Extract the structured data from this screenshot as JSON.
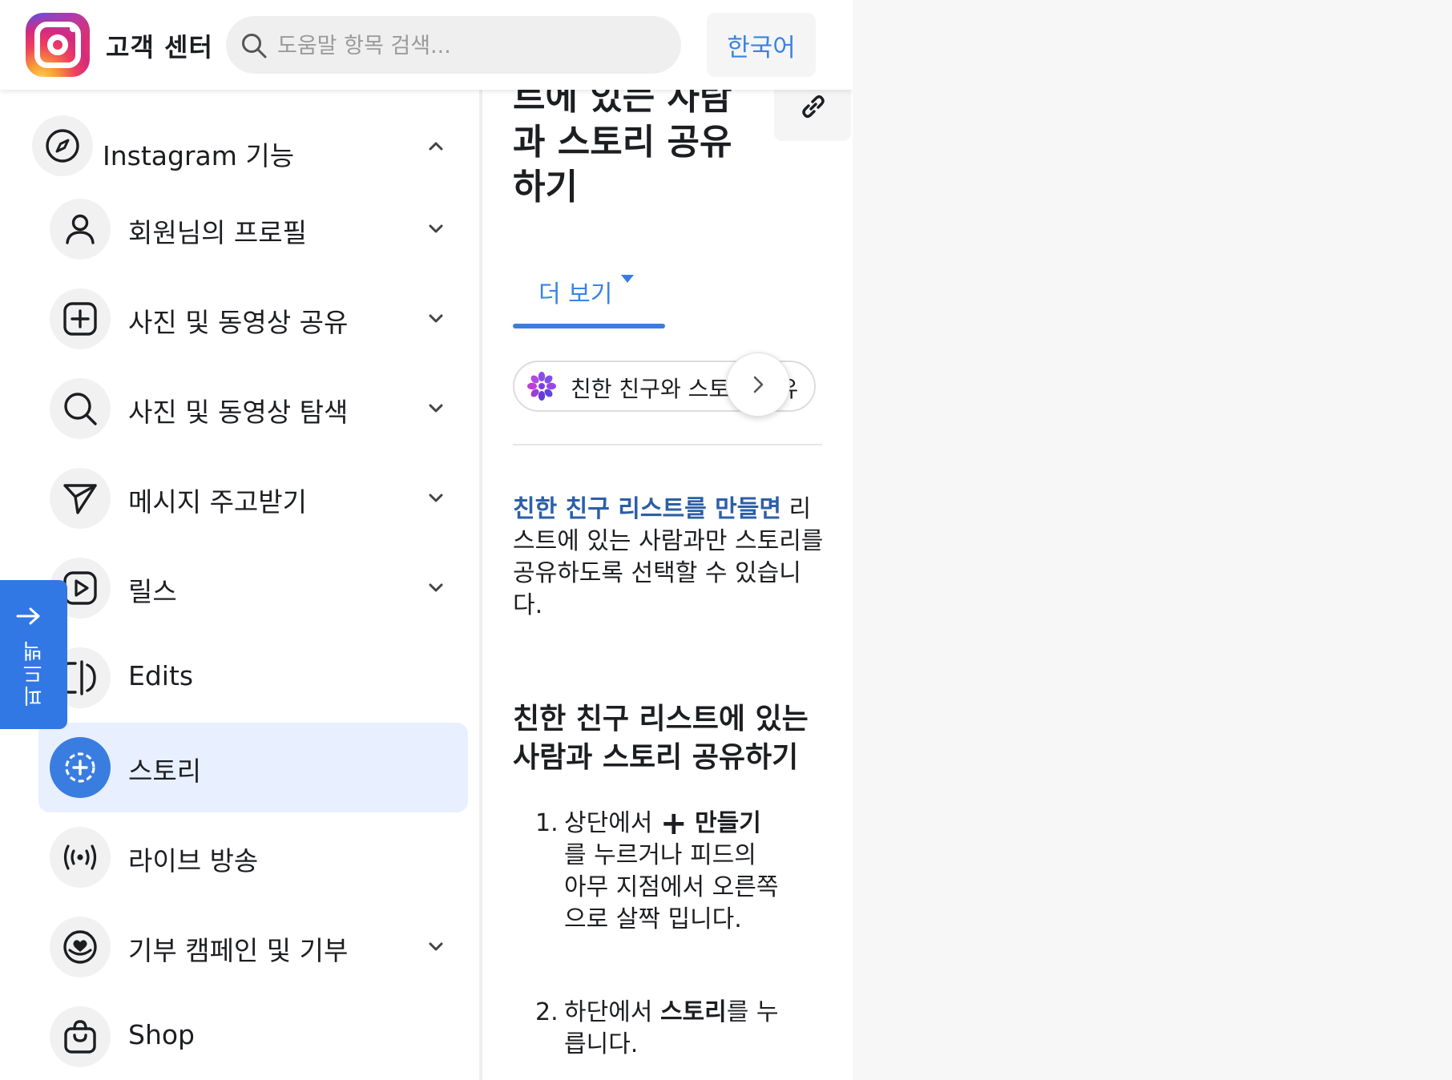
{
  "header": {
    "title": "고객 센터",
    "search_placeholder": "도움말 항목 검색...",
    "language_label": "한국어"
  },
  "sidebar": {
    "section": {
      "label": "Instagram 기능",
      "icon": "compass-icon",
      "expanded": true
    },
    "items": [
      {
        "label": "회원님의 프로필",
        "icon": "person-icon",
        "has_chevron": true,
        "active": false
      },
      {
        "label": "사진 및 동영상 공유",
        "icon": "plus-square-icon",
        "has_chevron": true,
        "active": false
      },
      {
        "label": "사진 및 동영상 탐색",
        "icon": "search-icon",
        "has_chevron": true,
        "active": false
      },
      {
        "label": "메시지 주고받기",
        "icon": "paper-plane-icon",
        "has_chevron": true,
        "active": false
      },
      {
        "label": "릴스",
        "icon": "reels-icon",
        "has_chevron": true,
        "active": false
      },
      {
        "label": "Edits",
        "icon": "edits-icon",
        "has_chevron": false,
        "active": false
      },
      {
        "label": "스토리",
        "icon": "story-add-icon",
        "has_chevron": false,
        "active": true
      },
      {
        "label": "라이브 방송",
        "icon": "live-broadcast-icon",
        "has_chevron": false,
        "active": false
      },
      {
        "label": "기부 캠페인 및 기부",
        "icon": "heart-donation-icon",
        "has_chevron": true,
        "active": false
      },
      {
        "label": "Shop",
        "icon": "shopping-bag-icon",
        "has_chevron": false,
        "active": false
      }
    ]
  },
  "feedback": {
    "label": "피드백"
  },
  "article": {
    "title_lines": [
      "트에 있는 사람",
      "과 스토리 공유",
      "하기"
    ],
    "more_label": "더 보기",
    "chip_label": "친한 친구와 스토리 공유",
    "intro_link": "친한 친구 리스트를 만들면",
    "intro_rest": " 리스트에 있는 사람과만 스토리를 공유하도록 선택할 수 있습니다.",
    "section_title": "친한 친구 리스트에 있는 사람과 스토리 공유하기",
    "steps": [
      {
        "num": "1.",
        "before": "상단에서 ",
        "icon_glyph": "+",
        "bold": "만들기",
        "after": "를 누르거나 피드의 아무 지점에서 오른쪽으로 살짝 밉니다."
      },
      {
        "num": "2.",
        "before": "하단에서 ",
        "bold": "스토리",
        "after": "를 누릅니다."
      }
    ]
  },
  "colors": {
    "accent": "#3a7de0",
    "link_blue": "#3a83e3",
    "active_bg": "#e8efff",
    "feedback_bg": "#3178e5"
  }
}
